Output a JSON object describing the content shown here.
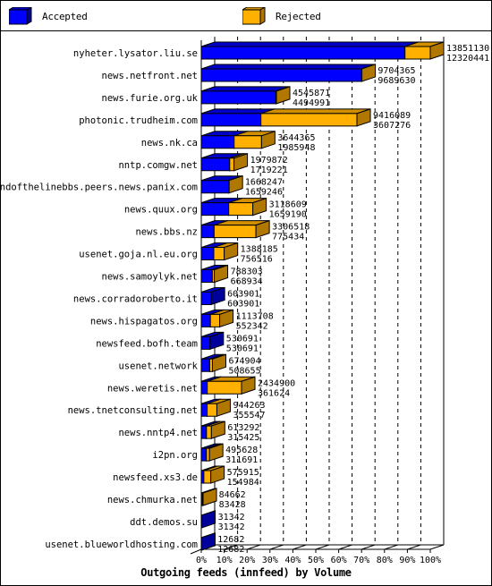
{
  "colors": {
    "accepted_front": "#0000ff",
    "accepted_top": "#0000c8",
    "accepted_side": "#00009a",
    "rejected_front": "#ffb000",
    "rejected_top": "#d29000",
    "rejected_side": "#b07800"
  },
  "chart_data": {
    "type": "bar",
    "orientation": "horizontal",
    "stacked": true,
    "style": "3d",
    "title": "Outgoing feeds (innfeed) by Volume",
    "xlabel": "",
    "ylabel": "",
    "xlim": [
      0,
      100
    ],
    "x_unit": "percent of maximum total",
    "x_ticks": [
      "0%",
      "10%",
      "20%",
      "30%",
      "40%",
      "50%",
      "60%",
      "70%",
      "80%",
      "90%",
      "100%"
    ],
    "grid": "vertical dashed",
    "legend": {
      "placement": "top",
      "entries": [
        "Accepted",
        "Rejected"
      ]
    },
    "categories": [
      "nyheter.lysator.liu.se",
      "news.netfront.net",
      "news.furie.org.uk",
      "photonic.trudheim.com",
      "news.nk.ca",
      "nntp.comgw.net",
      "endofthelinebbs.peers.news.panix.com",
      "news.quux.org",
      "news.bbs.nz",
      "usenet.goja.nl.eu.org",
      "news.samoylyk.net",
      "news.corradoroberto.it",
      "news.hispagatos.org",
      "newsfeed.bofh.team",
      "usenet.network",
      "news.weretis.net",
      "news.tnetconsulting.net",
      "news.nntp4.net",
      "i2pn.org",
      "newsfeed.xs3.de",
      "news.chmurka.net",
      "ddt.demos.su",
      "usenet.blueworldhosting.com"
    ],
    "totals": [
      13851130,
      9704365,
      4545871,
      9416089,
      3644365,
      1979872,
      1668247,
      3118609,
      3306518,
      1388185,
      788303,
      603901,
      1113708,
      530691,
      674904,
      2434900,
      944263,
      613292,
      495628,
      575915,
      84662,
      31342,
      12682
    ],
    "series": [
      {
        "name": "Accepted",
        "values": [
          12320441,
          9689630,
          4494991,
          3607276,
          1985948,
          1719221,
          1659246,
          1659190,
          775434,
          756516,
          668934,
          603901,
          552342,
          530691,
          508655,
          361624,
          355547,
          315425,
          311691,
          154984,
          83428,
          31342,
          12682
        ]
      },
      {
        "name": "Rejected",
        "values": [
          1530689,
          14735,
          50880,
          5808813,
          1658417,
          260651,
          9001,
          1459419,
          2531084,
          631669,
          119369,
          0,
          561366,
          0,
          166249,
          2073276,
          588716,
          297867,
          183937,
          420931,
          1234,
          0,
          0
        ]
      }
    ]
  }
}
